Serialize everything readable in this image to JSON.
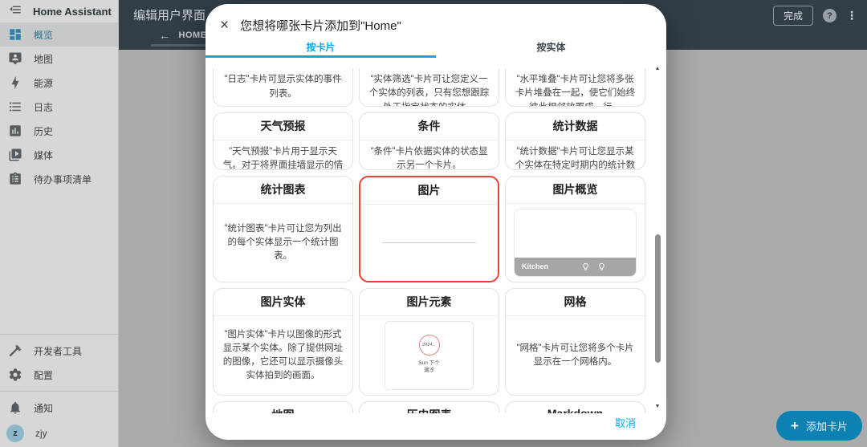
{
  "colors": {
    "accent": "#03a9f4",
    "highlight_red": "#ef4036",
    "topbar_bg": "#313e46",
    "fab_bg": "#0d81b1"
  },
  "sidebar": {
    "app_title": "Home Assistant",
    "items": [
      {
        "label": "概览",
        "icon": "view-dashboard-icon",
        "selected": true
      },
      {
        "label": "地图",
        "icon": "tooltip-account-icon"
      },
      {
        "label": "能源",
        "icon": "lightning-bolt-icon"
      },
      {
        "label": "日志",
        "icon": "list-bulleted-icon"
      },
      {
        "label": "历史",
        "icon": "chart-box-icon"
      },
      {
        "label": "媒体",
        "icon": "play-box-icon"
      },
      {
        "label": "待办事项清单",
        "icon": "clipboard-list-icon"
      }
    ],
    "tools": [
      {
        "label": "开发者工具",
        "icon": "hammer-icon"
      },
      {
        "label": "配置",
        "icon": "gear-icon"
      }
    ],
    "notifications": {
      "label": "通知",
      "icon": "bell-icon"
    },
    "user": {
      "name": "zjy",
      "initial": "z"
    }
  },
  "topbar": {
    "title": "编辑用户界面",
    "back_arrow": "←",
    "tab": "HOME",
    "edit_pencil": "✎",
    "done": "完成",
    "help": "?",
    "kebab": "⋮"
  },
  "dialog": {
    "title": "您想将哪张卡片添加到\"Home\"",
    "close": "×",
    "tabs": {
      "by_card": "按卡片",
      "by_entity": "按实体"
    },
    "cards": [
      {
        "description": "\"日志\"卡片可显示实体的事件列表。"
      },
      {
        "description": "\"实体筛选\"卡片可让您定义一个实体的列表，只有您想跟踪处于指定状态的实体。"
      },
      {
        "description": "\"水平堆叠\"卡片可让您将多张卡片堆叠在一起，使它们始终彼此相邻放置成一行。"
      },
      {
        "title": "天气预报",
        "description": "\"天气预报\"卡片用于显示天气。对于将界面挂墙显示的情况非常有用。"
      },
      {
        "title": "条件",
        "description": "\"条件\"卡片依据实体的状态显示另一个卡片。"
      },
      {
        "title": "统计数据",
        "description": "\"统计数据\"卡片可让您显示某个实体在特定时期内的统计数值。"
      },
      {
        "title": "统计图表",
        "description": "\"统计图表\"卡片可让您为列出的每个实体显示一个统计图表。"
      },
      {
        "title": "图片",
        "highlighted": true
      },
      {
        "title": "图片概览",
        "preview": {
          "label": "Kitchen"
        }
      },
      {
        "title": "图片实体",
        "description": "\"图片实体\"卡片以图像的形式显示某个实体。除了提供网址的图像，它还可以显示摄像头实体拍到的画面。"
      },
      {
        "title": "图片元素",
        "preview": {
          "badge": "2024...",
          "caption_line1": "Sun 下个",
          "caption_line2": "潮汐"
        }
      },
      {
        "title": "网格",
        "description": "\"网格\"卡片可让您将多个卡片显示在一个网格内。"
      },
      {
        "title": "地图"
      },
      {
        "title": "历史图表"
      },
      {
        "title": "Markdown"
      }
    ],
    "cancel": "取消"
  },
  "fab": {
    "label": "添加卡片",
    "icon": "plus-icon"
  }
}
